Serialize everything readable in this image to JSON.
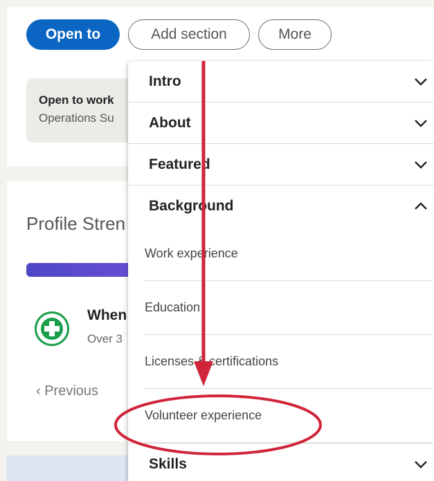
{
  "profile_actions": {
    "open_to": "Open to",
    "add_section": "Add section",
    "more": "More"
  },
  "open_to_work": {
    "title": "Open to work",
    "subtitle": "Operations Su"
  },
  "profile_strength": {
    "title": "Profile Stren",
    "suggestion_title": "When",
    "suggestion_sub": "Over 3",
    "previous": "Previous"
  },
  "dropdown": {
    "sections": [
      {
        "label": "Intro",
        "expanded": false
      },
      {
        "label": "About",
        "expanded": false
      },
      {
        "label": "Featured",
        "expanded": false
      },
      {
        "label": "Background",
        "expanded": true
      },
      {
        "label": "Skills",
        "expanded": false
      }
    ],
    "background_items": [
      "Work experience",
      "Education",
      "Licenses & certifications",
      "Volunteer experience"
    ]
  },
  "colors": {
    "primary": "#0a66c2",
    "annotation": "#d0243a",
    "strength_bar": "#4f46c8",
    "logo_green": "#1b9e4b"
  },
  "icons": {
    "chevron_down": "chevron-down-icon",
    "chevron_up": "chevron-up-icon",
    "previous": "chevron-left-icon"
  }
}
